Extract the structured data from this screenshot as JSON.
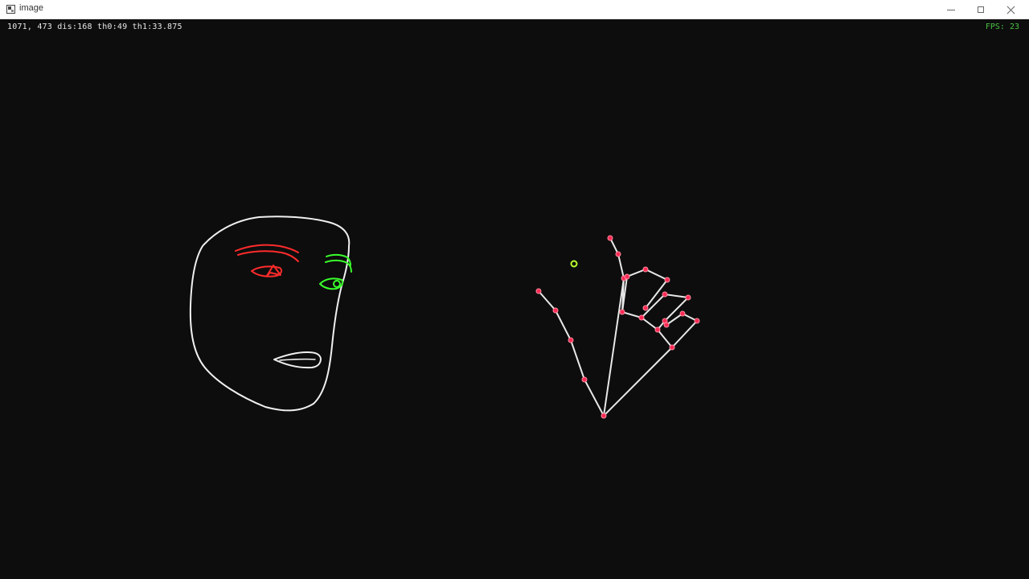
{
  "window": {
    "title": "image",
    "icon": "app-window-icon",
    "controls": [
      "minimize-icon",
      "maximize-icon",
      "close-icon"
    ]
  },
  "overlay": {
    "coords_text": "1071, 473 dis:168 th0:49 th1:33.875",
    "fps_text": "FPS: 23"
  },
  "colors": {
    "background": "#0d0d0d",
    "face_outline": "#f0f0f0",
    "right_eye": "#ff2b2b",
    "left_eye": "#39ff2b",
    "hand_lines": "#e8e8e8",
    "hand_joints": "#ff2b55",
    "pointer_marker": "#b6ff2b",
    "fps": "#4ac043"
  }
}
